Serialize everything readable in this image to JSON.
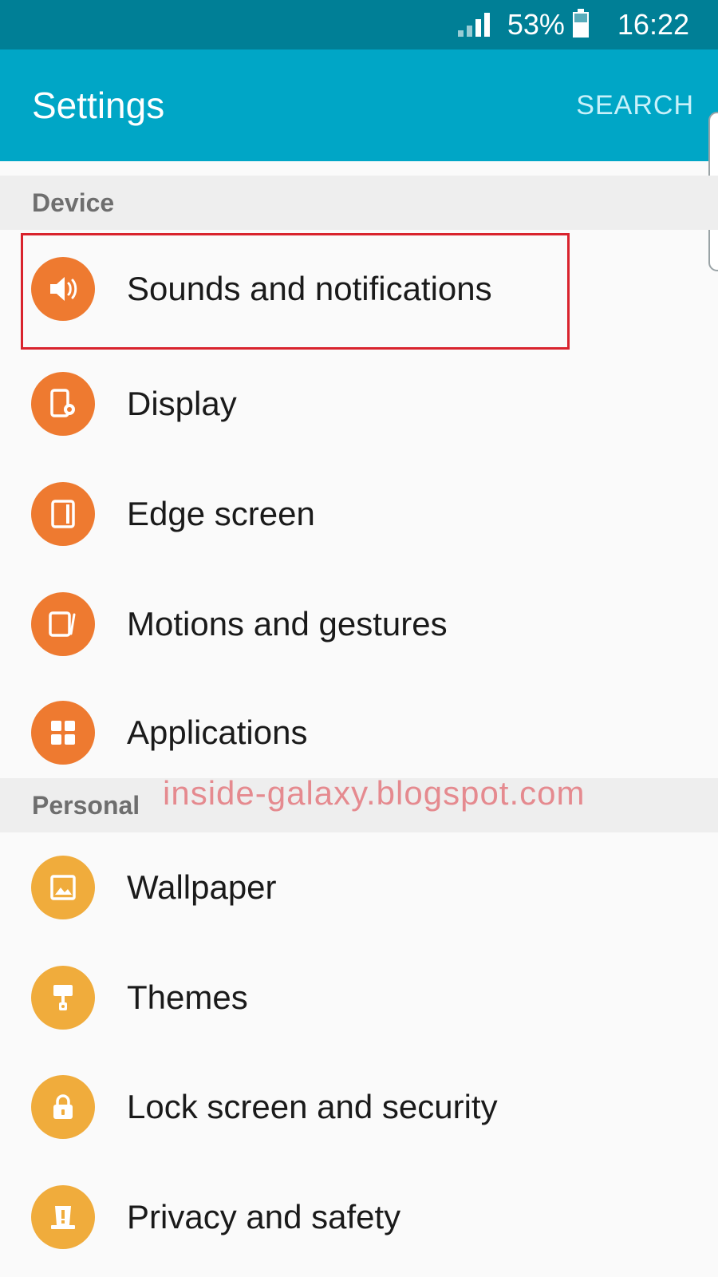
{
  "status_bar": {
    "battery": "53%",
    "time": "16:22"
  },
  "app_bar": {
    "title": "Settings",
    "search_label": "SEARCH"
  },
  "sections": [
    {
      "header": "Device",
      "items": [
        {
          "label": "Sounds and notifications",
          "icon": "speaker-icon"
        },
        {
          "label": "Display",
          "icon": "display-settings-icon"
        },
        {
          "label": "Edge screen",
          "icon": "edge-screen-icon"
        },
        {
          "label": "Motions and gestures",
          "icon": "motion-icon"
        },
        {
          "label": "Applications",
          "icon": "apps-grid-icon"
        }
      ]
    },
    {
      "header": "Personal",
      "items": [
        {
          "label": "Wallpaper",
          "icon": "wallpaper-icon"
        },
        {
          "label": "Themes",
          "icon": "paint-roller-icon"
        },
        {
          "label": "Lock screen and security",
          "icon": "lock-icon"
        },
        {
          "label": "Privacy and safety",
          "icon": "alert-icon"
        }
      ]
    }
  ],
  "colors": {
    "status_bar": "#007f96",
    "app_bar": "#00a6c6",
    "device_icon": "#ee7a30",
    "personal_icon": "#f0ac3c",
    "highlight": "#d9232d"
  },
  "watermark": "inside-galaxy.blogspot.com"
}
